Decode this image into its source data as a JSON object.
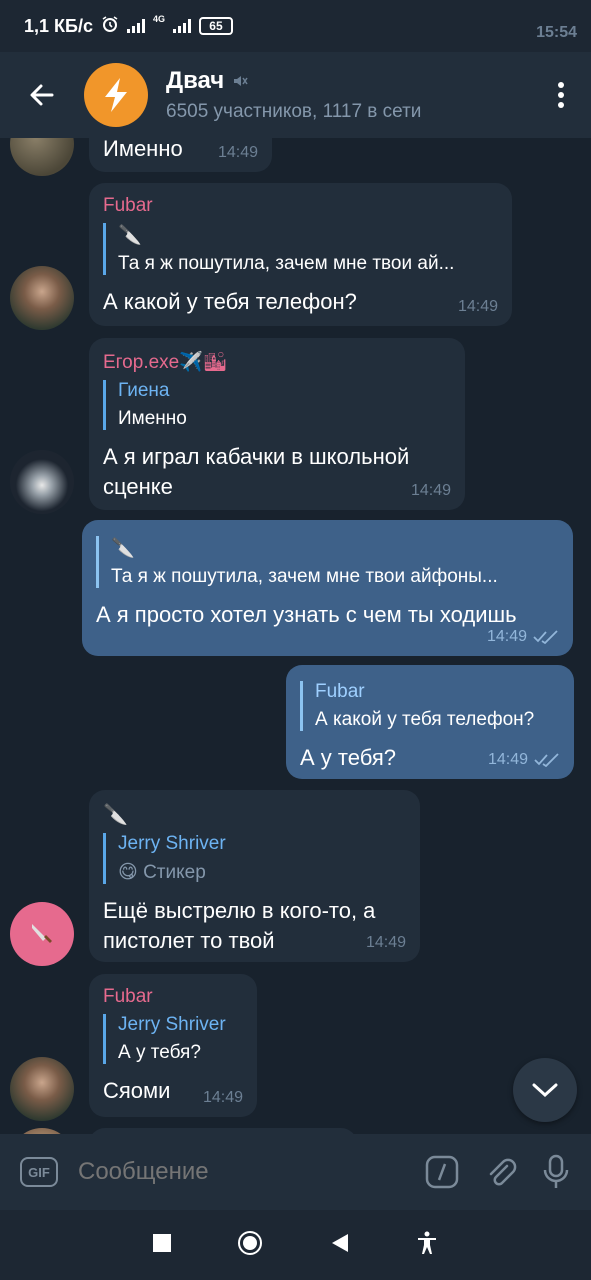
{
  "status_bar": {
    "time": "15:54",
    "net_speed": "1,1 КБ/с",
    "network_label": "4G",
    "battery": "65"
  },
  "header": {
    "title": "Двач",
    "subtitle": "6505 участников, 1117 в сети"
  },
  "messages": [
    {
      "text": "Именно",
      "time": "14:49"
    },
    {
      "sender": "Fubar",
      "reply_name": "🔪",
      "reply_text": "Та я ж пошутила, зачем мне твои ай...",
      "text": "А какой у тебя телефон?",
      "time": "14:49"
    },
    {
      "sender": "Егор.exe✈️🏙",
      "reply_name": "Гиена",
      "reply_text": "Именно",
      "text": "А я играл кабачки в школьной сценке",
      "time": "14:49"
    },
    {
      "reply_name": "🔪",
      "reply_text": "Та я ж пошутила, зачем мне твои айфоны...",
      "text": "А я просто хотел узнать с чем ты ходишь",
      "time": "14:49"
    },
    {
      "reply_name": "Fubar",
      "reply_text": "А какой у тебя телефон?",
      "text": "А у тебя?",
      "time": "14:49"
    },
    {
      "sender": "🔪",
      "reply_name": "Jerry Shriver",
      "reply_text": "😋 Стикер",
      "text": "Ещё выстрелю в кого-то, а пистолет то твой",
      "time": "14:49"
    },
    {
      "sender": "Fubar",
      "reply_name": "Jerry Shriver",
      "reply_text": "А у тебя?",
      "text": "Сяоми",
      "time": "14:49"
    }
  ],
  "input": {
    "gif_label": "GIF",
    "placeholder": "Сообщение"
  },
  "colors": {
    "background": "#18222d",
    "header": "#222e3b",
    "incoming_bubble": "#222e3b",
    "outgoing_bubble": "#3e6189",
    "sender_pink": "#e66a8e",
    "reply_blue": "#6db3f2",
    "channel_avatar": "#f1962a"
  },
  "icons": {
    "back": "arrow-left-icon",
    "muted": "speaker-muted-icon",
    "menu": "vertical-dots-icon",
    "scroll_down": "chevron-down-icon",
    "commands": "slash-command-icon",
    "attach": "paperclip-icon",
    "mic": "microphone-icon"
  }
}
